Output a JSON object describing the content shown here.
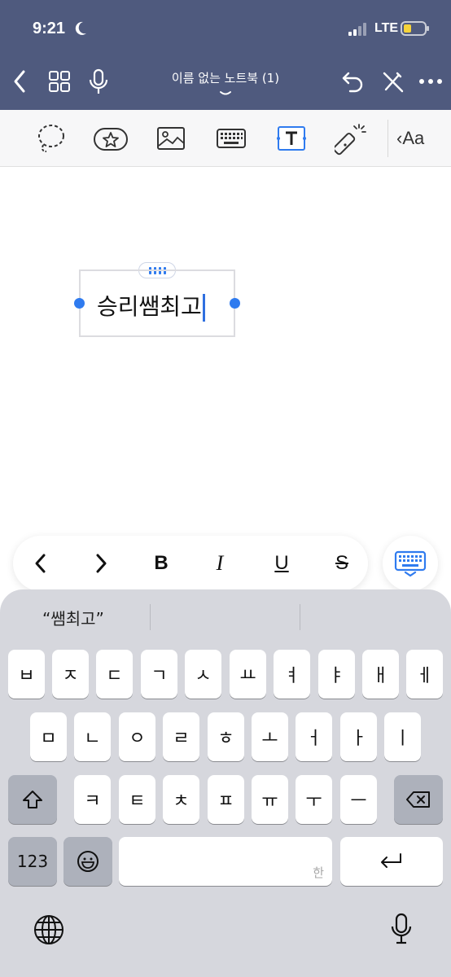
{
  "status_bar": {
    "time": "9:21",
    "network": "LTE",
    "icons": [
      "moon-icon",
      "signal-icon",
      "battery-icon"
    ]
  },
  "nav": {
    "title": "이름 없는 노트북 (1)",
    "icons": [
      "back-icon",
      "grid-icon",
      "mic-icon",
      "undo-icon",
      "pen-off-icon",
      "more-icon"
    ]
  },
  "toolbar": {
    "tools": [
      "lasso-icon",
      "sticker-icon",
      "image-icon",
      "keyboard-icon",
      "textbox-icon",
      "laser-pointer-icon"
    ],
    "aa_label": "Aa",
    "aa_chevron": "‹"
  },
  "canvas": {
    "text": "승리쌤최고"
  },
  "format_bar": {
    "prev": "‹",
    "next": "›",
    "bold": "B",
    "italic": "I",
    "underline": "U",
    "strike": "S"
  },
  "keyboard": {
    "suggestions": [
      "“쌤최고”",
      "",
      ""
    ],
    "row1": [
      "ㅂ",
      "ㅈ",
      "ㄷ",
      "ㄱ",
      "ㅅ",
      "ㅛ",
      "ㅕ",
      "ㅑ",
      "ㅐ",
      "ㅔ"
    ],
    "row2": [
      "ㅁ",
      "ㄴ",
      "ㅇ",
      "ㄹ",
      "ㅎ",
      "ㅗ",
      "ㅓ",
      "ㅏ",
      "ㅣ"
    ],
    "row3": [
      "ㅋ",
      "ㅌ",
      "ㅊ",
      "ㅍ",
      "ㅠ",
      "ㅜ",
      "ㅡ"
    ],
    "numbers_label": "123",
    "space_lang": "한"
  },
  "colors": {
    "header_bg": "#4f5a7e",
    "accent": "#2f7bef",
    "keyboard_bg": "#d6d7dd"
  }
}
